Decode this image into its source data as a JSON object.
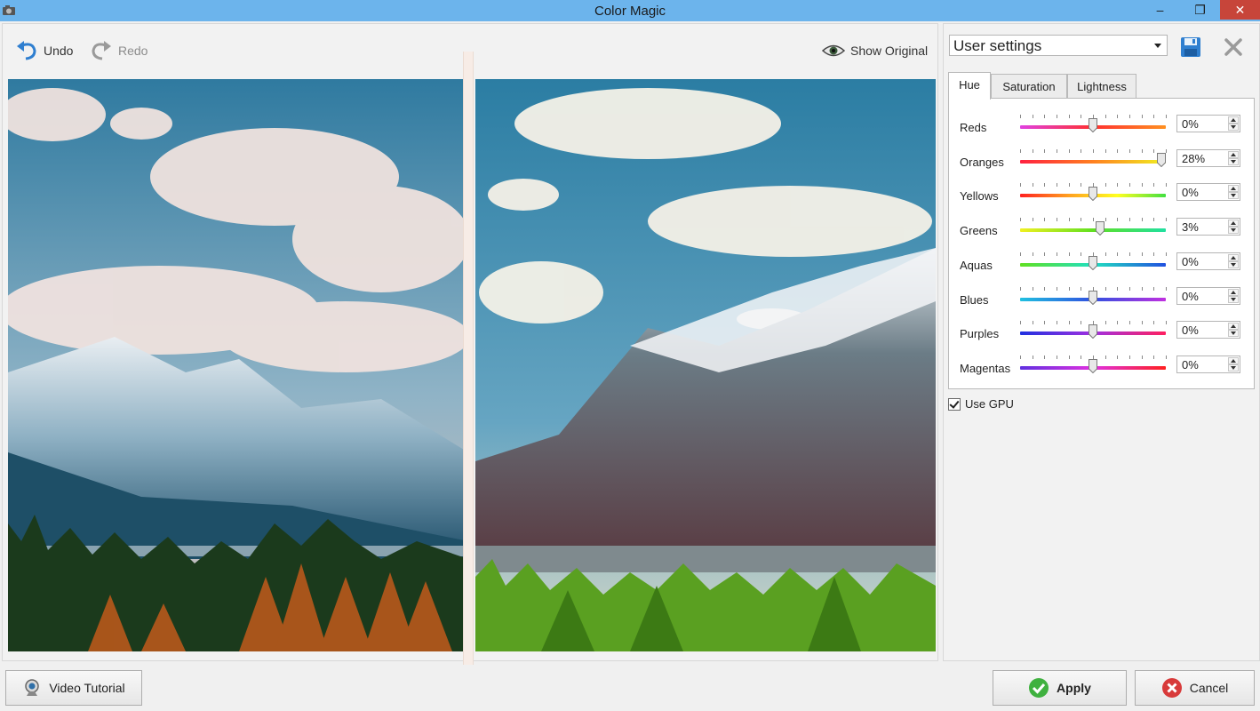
{
  "window": {
    "title": "Color Magic",
    "controls": {
      "minimize": "–",
      "maximize": "❐",
      "close": "✕"
    }
  },
  "toolbar": {
    "undo_label": "Undo",
    "redo_label": "Redo",
    "show_original_label": "Show Original"
  },
  "preview": {
    "before_after_split": true
  },
  "panel": {
    "preset_value": "User settings",
    "tabs": [
      {
        "label": "Hue",
        "active": true
      },
      {
        "label": "Saturation",
        "active": false
      },
      {
        "label": "Lightness",
        "active": false
      }
    ],
    "sliders": [
      {
        "name": "Reds",
        "value": 0,
        "value_text": "0%"
      },
      {
        "name": "Oranges",
        "value": 28,
        "value_text": "28%"
      },
      {
        "name": "Yellows",
        "value": 0,
        "value_text": "0%"
      },
      {
        "name": "Greens",
        "value": 3,
        "value_text": "3%"
      },
      {
        "name": "Aquas",
        "value": 0,
        "value_text": "0%"
      },
      {
        "name": "Blues",
        "value": 0,
        "value_text": "0%"
      },
      {
        "name": "Purples",
        "value": 0,
        "value_text": "0%"
      },
      {
        "name": "Magentas",
        "value": 0,
        "value_text": "0%"
      }
    ],
    "slider_range": [
      -30,
      30
    ],
    "use_gpu_label": "Use GPU",
    "use_gpu_checked": true
  },
  "footer": {
    "video_tutorial_label": "Video Tutorial",
    "apply_label": "Apply",
    "cancel_label": "Cancel"
  },
  "colors": {
    "titlebar": "#6cb4ec",
    "close_button": "#c7453a",
    "apply_icon": "#3fb13f",
    "cancel_icon": "#d83a3a",
    "save_icon": "#2f7fd0"
  }
}
